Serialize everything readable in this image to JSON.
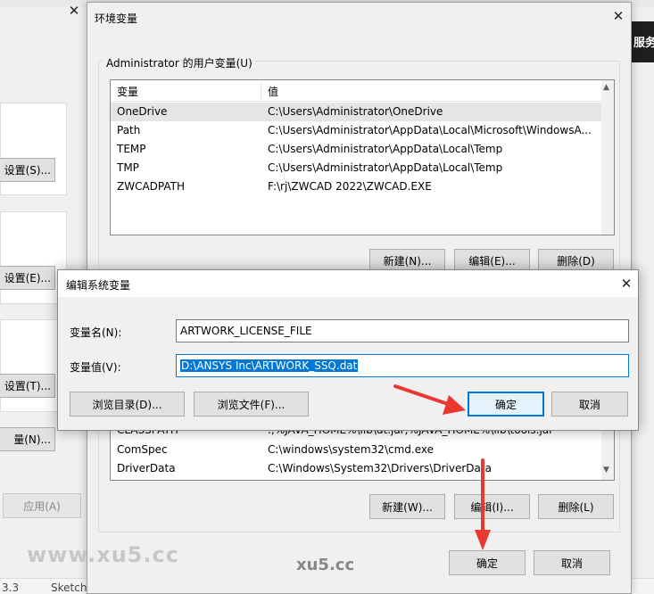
{
  "browser_tabs": [
    {
      "label": "..."
    },
    {
      "label": "..."
    },
    {
      "label": "..."
    },
    {
      "label": "..."
    }
  ],
  "right_edge_text": "服务",
  "background_window": {
    "btn_settings_s": "设置(S)...",
    "btn_settings_e": "设置(E)...",
    "btn_settings_t": "设置(T)...",
    "btn_vars_n": "量(N)...",
    "btn_apply": "应用(A)",
    "bottom_left_num": "3.3",
    "bottom_left_text": "Sketch..."
  },
  "env_window": {
    "title": "环境变量",
    "user_group_label": "Administrator 的用户变量(U)",
    "columns": {
      "name": "变量",
      "value": "值"
    },
    "user_vars": [
      {
        "name": "OneDrive",
        "value": "C:\\Users\\Administrator\\OneDrive"
      },
      {
        "name": "Path",
        "value": "C:\\Users\\Administrator\\AppData\\Local\\Microsoft\\WindowsA..."
      },
      {
        "name": "TEMP",
        "value": "C:\\Users\\Administrator\\AppData\\Local\\Temp"
      },
      {
        "name": "TMP",
        "value": "C:\\Users\\Administrator\\AppData\\Local\\Temp"
      },
      {
        "name": "ZWCADPATH",
        "value": "F:\\rj\\ZWCAD 2022\\ZWCAD.EXE"
      }
    ],
    "user_buttons": {
      "new": "新建(N)...",
      "edit": "编辑(E)...",
      "delete": "删除(D)"
    },
    "system_vars": [
      {
        "name": "CLASSPATH",
        "value": ".;%JAVA_HOME%\\lib\\dt.jar;%JAVA_HOME%\\lib\\tools.jar"
      },
      {
        "name": "ComSpec",
        "value": "C:\\windows\\system32\\cmd.exe"
      },
      {
        "name": "DriverData",
        "value": "C:\\Windows\\System32\\Drivers\\DriverData"
      }
    ],
    "system_buttons": {
      "new": "新建(W)...",
      "edit": "编辑(I)...",
      "delete": "删除(L)"
    },
    "ok": "确定",
    "cancel": "取消"
  },
  "edit_dialog": {
    "title": "编辑系统变量",
    "name_label": "变量名(N):",
    "name_value": "ARTWORK_LICENSE_FILE",
    "value_label": "变量值(V):",
    "value_value": "D:\\ANSYS Inc\\ARTWORK_SSQ.dat",
    "browse_dir": "浏览目录(D)...",
    "browse_file": "浏览文件(F)...",
    "ok": "确定",
    "cancel": "取消"
  },
  "watermarks": {
    "left": "www.xu5.cc",
    "center": "xu5.cc"
  },
  "colors": {
    "accent": "#0078d7",
    "arrow": "#e8382f",
    "window_bg": "#f0f0f0"
  }
}
